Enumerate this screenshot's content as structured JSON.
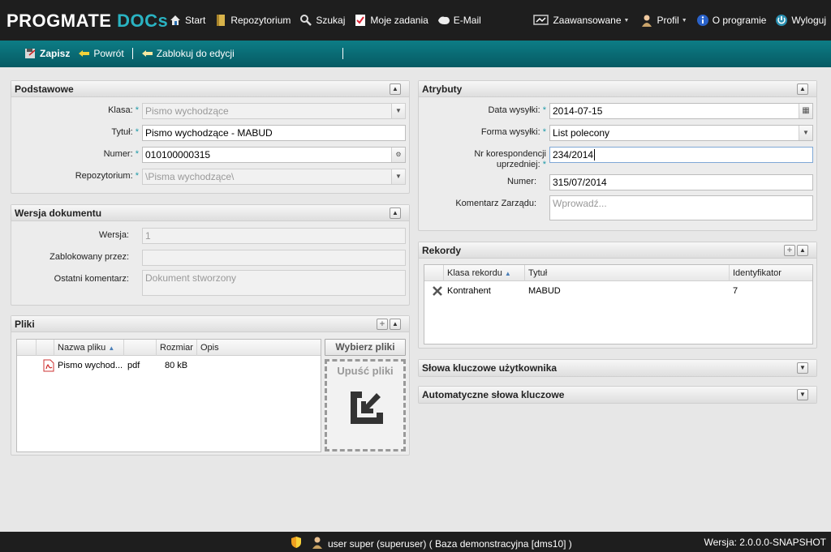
{
  "app": {
    "logo_main": "PROGMATE ",
    "logo_accent": "DOCs"
  },
  "nav_left": [
    "Start",
    "Repozytorium",
    "Szukaj",
    "Moje zadania",
    "E-Mail"
  ],
  "nav_right": {
    "advanced": "Zaawansowane",
    "profile": "Profil",
    "about": "O programie",
    "logout": "Wyloguj"
  },
  "toolbar": {
    "save": "Zapisz",
    "back": "Powrót",
    "lock": "Zablokuj do edycji"
  },
  "basic": {
    "title": "Podstawowe",
    "class_label": "Klasa:",
    "class_value": "Pismo wychodzące",
    "title_label": "Tytuł:",
    "title_value": "Pismo wychodzące - MABUD",
    "number_label": "Numer:",
    "number_value": "010100000315",
    "repo_label": "Repozytorium:",
    "repo_value": "\\Pisma wychodzące\\"
  },
  "version": {
    "title": "Wersja dokumentu",
    "version_label": "Wersja:",
    "version_value": "1",
    "locked_label": "Zablokowany przez:",
    "locked_value": "",
    "comment_label": "Ostatni komentarz:",
    "comment_value": "Dokument stworzony"
  },
  "files": {
    "title": "Pliki",
    "columns": [
      "Nazwa pliku",
      "Rozmiar",
      "Opis"
    ],
    "rows": [
      {
        "name": "Pismo wychod...",
        "ext": "pdf",
        "size": "80 kB",
        "desc": ""
      }
    ],
    "choose": "Wybierz pliki",
    "drop": "Upuść pliki"
  },
  "attributes": {
    "title": "Atrybuty",
    "send_date_label": "Data wysyłki:",
    "send_date_value": "2014-07-15",
    "send_form_label": "Forma wysyłki:",
    "send_form_value": "List polecony",
    "prev_corr_label_1": "Nr korespondencji",
    "prev_corr_label_2": "uprzedniej:",
    "prev_corr_value": "234/2014",
    "number_label": "Numer:",
    "number_value": "315/07/2014",
    "board_comment_label": "Komentarz Zarządu:",
    "board_comment_placeholder": "Wprowadź..."
  },
  "records": {
    "title": "Rekordy",
    "columns": [
      "Klasa rekordu",
      "Tytuł",
      "Identyfikator"
    ],
    "rows": [
      {
        "class": "Kontrahent",
        "title": "MABUD",
        "id": "7"
      }
    ]
  },
  "user_keywords": {
    "title": "Słowa kluczowe użytkownika"
  },
  "auto_keywords": {
    "title": "Automatyczne słowa kluczowe"
  },
  "footer": {
    "user": "user super (superuser) ( Baza demonstracyjna [dms10] )",
    "version": "Wersja: 2.0.0.0-SNAPSHOT"
  },
  "colors": {
    "accent": "#2ab3c2",
    "toolbar": "#0a6b74",
    "topbar": "#1e1e1e",
    "required": "#1e9aa8"
  },
  "icons": [
    "home-icon",
    "repository-icon",
    "search-icon",
    "tasks-icon",
    "mail-icon",
    "advanced-icon",
    "profile-icon",
    "info-icon",
    "logout-icon",
    "save-icon",
    "back-icon",
    "lock-icon",
    "calendar-icon",
    "chevron-down-icon",
    "generate-icon",
    "pdf-icon",
    "delete-icon",
    "drop-icon",
    "collapse-icon",
    "expand-icon",
    "add-icon",
    "shield-icon",
    "user-icon"
  ]
}
